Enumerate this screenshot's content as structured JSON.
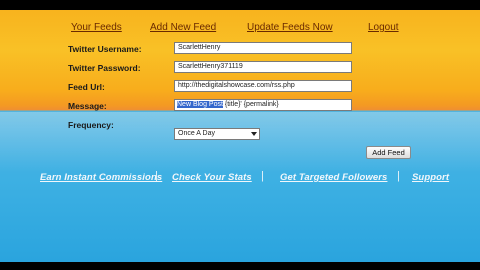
{
  "nav": {
    "your_feeds": "Your Feeds",
    "add_new_feed": "Add New Feed",
    "update_feeds_now": "Update Feeds Now",
    "logout": "Logout"
  },
  "form": {
    "twitter_username": {
      "label": "Twitter Username:",
      "value": "ScarlettHenry"
    },
    "twitter_password": {
      "label": "Twitter Password:",
      "value": "ScarlettHenry371119"
    },
    "feed_url": {
      "label": "Feed Url:",
      "value": "http://thedigitalshowcase.com/rss.php"
    },
    "message": {
      "label": "Message:",
      "selected_text": "New Blog Post",
      "rest_text": " {title}' {permalink}"
    },
    "frequency": {
      "label": "Frequency:",
      "value": "Once A Day"
    },
    "submit_label": "Add Feed"
  },
  "footer": {
    "links": [
      "Earn Instant Commissions",
      "Check Your Stats",
      "Get Targeted Followers",
      "Support"
    ],
    "separator": "|"
  },
  "colors": {
    "top_gradient": "#f9c126",
    "bottom_blue": "#3db0e3",
    "nav_text": "#6a2a00",
    "selection": "#3366cc"
  }
}
